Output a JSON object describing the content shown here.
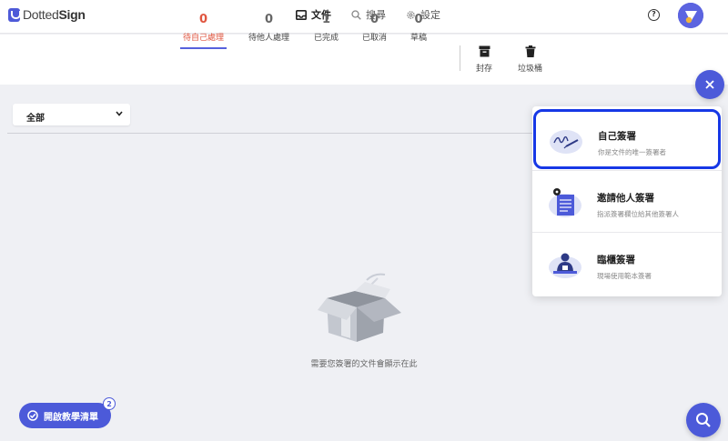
{
  "app": {
    "logo_part1": "Dotted",
    "logo_part2": "Sign"
  },
  "nav": {
    "documents": "文件",
    "search": "搜尋",
    "settings": "設定"
  },
  "header": {
    "help_label": "?"
  },
  "colors": {
    "accent": "#4c5ad9",
    "active_tab": "#e0553f",
    "highlight": "#1738e6"
  },
  "status_tabs": [
    {
      "count": "0",
      "label": "待自己處理",
      "active": true
    },
    {
      "count": "0",
      "label": "待他人處理"
    },
    {
      "count": "1",
      "label": "已完成"
    },
    {
      "count": "0",
      "label": "已取消"
    },
    {
      "count": "0",
      "label": "草稿"
    }
  ],
  "tools": {
    "archive": "封存",
    "trash": "垃圾桶"
  },
  "filter": {
    "selected": "全部"
  },
  "empty_state": {
    "message": "需要您簽署的文件會顯示在此"
  },
  "tutorial": {
    "label": "開啟教學清單",
    "badge": "2"
  },
  "sign_menu": {
    "items": [
      {
        "title": "自己簽署",
        "desc": "你是文件的唯一簽署者"
      },
      {
        "title": "邀請他人簽署",
        "desc": "指派簽署欄位給其他簽署人"
      },
      {
        "title": "臨櫃簽署",
        "desc": "現場使用範本簽署"
      }
    ]
  }
}
